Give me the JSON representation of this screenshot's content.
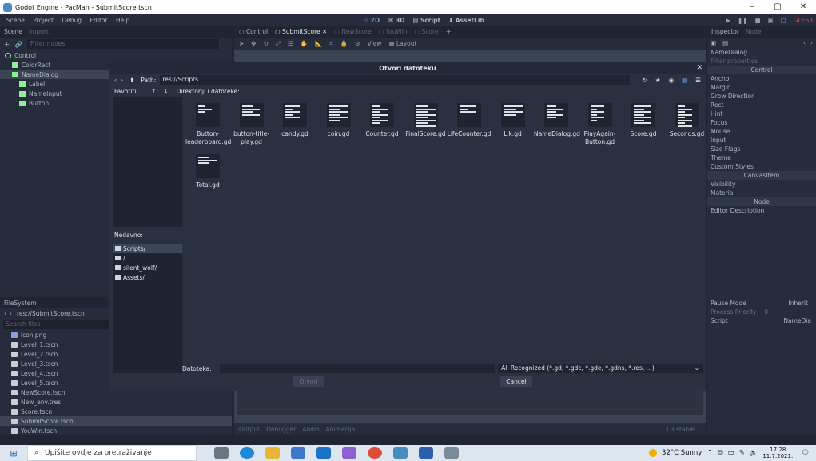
{
  "window": {
    "title": "Godot Engine - PacMan - SubmitScore.tscn",
    "controls": [
      "–",
      "▢",
      "✕"
    ]
  },
  "menu": {
    "items": [
      "Scene",
      "Project",
      "Debug",
      "Editor",
      "Help"
    ],
    "workspaces": [
      "2D",
      "3D",
      "Script",
      "AssetLib"
    ],
    "renderer": "GLES3"
  },
  "scene_dock": {
    "tabs": [
      "Scene",
      "Import"
    ],
    "filter_placeholder": "Filter nodes",
    "nodes": [
      {
        "label": "Control",
        "indent": 0,
        "selected": false
      },
      {
        "label": "ColorRect",
        "indent": 1,
        "selected": false
      },
      {
        "label": "NameDialog",
        "indent": 1,
        "selected": true
      },
      {
        "label": "Label",
        "indent": 2,
        "selected": false
      },
      {
        "label": "NameInput",
        "indent": 2,
        "selected": false
      },
      {
        "label": "Button",
        "indent": 2,
        "selected": false
      }
    ]
  },
  "filesystem": {
    "tab": "FileSystem",
    "path": "res://SubmitScore.tscn",
    "search_placeholder": "Search files",
    "files": [
      "icon.png",
      "Level_1.tscn",
      "Level_2.tscn",
      "Level_3.tscn",
      "Level_4.tscn",
      "Level_5.tscn",
      "NewScore.tscn",
      "New_env.tres",
      "Score.tscn",
      "SubmitScore.tscn",
      "YouWin.tscn"
    ],
    "selected": "SubmitScore.tscn"
  },
  "scene_tabs": [
    "Control",
    "SubmitScore",
    "NewScore",
    "YouWin",
    "Score"
  ],
  "canvas_toolbar": {
    "view_label": "View",
    "layout_label": "Layout"
  },
  "bottom_panel": {
    "tabs": [
      "Output",
      "Debugger",
      "Audio",
      "Animacija"
    ],
    "version": "3.3.stable"
  },
  "inspector": {
    "tabs": [
      "Inspector",
      "Node"
    ],
    "object": "NameDialog",
    "filter_placeholder": "Filter properties",
    "rows": [
      "Control",
      "Anchor",
      "Margin",
      "Grow Direction",
      "Rect",
      "Hint",
      "Focus",
      "Mouse",
      "Input",
      "Size Flags",
      "Theme",
      "Custom Styles",
      "CanvasItem",
      "Visibility",
      "Material",
      "Node",
      "Editor Description"
    ],
    "categories": [
      "Control",
      "CanvasItem",
      "Node"
    ],
    "pause_mode_label": "Pause Mode",
    "pause_mode_value": "Inherit",
    "process_priority_label": "Process Priority",
    "process_priority_value": "0",
    "script_label": "Script",
    "script_value": "NameDia"
  },
  "dialog": {
    "title": "Otvori datoteku",
    "path_label": "Path:",
    "path_value": "res://Scripts",
    "favorites_label": "Favoriti:",
    "dirs_label": "Direktoriji i datoteke:",
    "recent_label": "Nedavno:",
    "recent": [
      "Scripts/",
      "/",
      "silent_wolf/",
      "Assets/"
    ],
    "selected_recent": "Scripts/",
    "files": [
      "Button-leaderboard.gd",
      "button-title-play.gd",
      "candy.gd",
      "coin.gd",
      "Counter.gd",
      "FinalScore.gd",
      "LifeCounter.gd",
      "Lik.gd",
      "NameDialog.gd",
      "PlayAgain-Button.gd",
      "Score.gd",
      "Seconds.gd",
      "Total.gd"
    ],
    "filename_label": "Datoteka:",
    "filter_value": "All Recognized (*.gd, *.gdc, *.gde, *.gdns, *.res, ...)",
    "open_button": "Otvori",
    "cancel_button": "Cancel"
  },
  "taskbar": {
    "search_placeholder": "Upišite ovdje za pretraživanje",
    "weather": "32°C Sunny",
    "time": "17:28",
    "date": "11.7.2021."
  }
}
